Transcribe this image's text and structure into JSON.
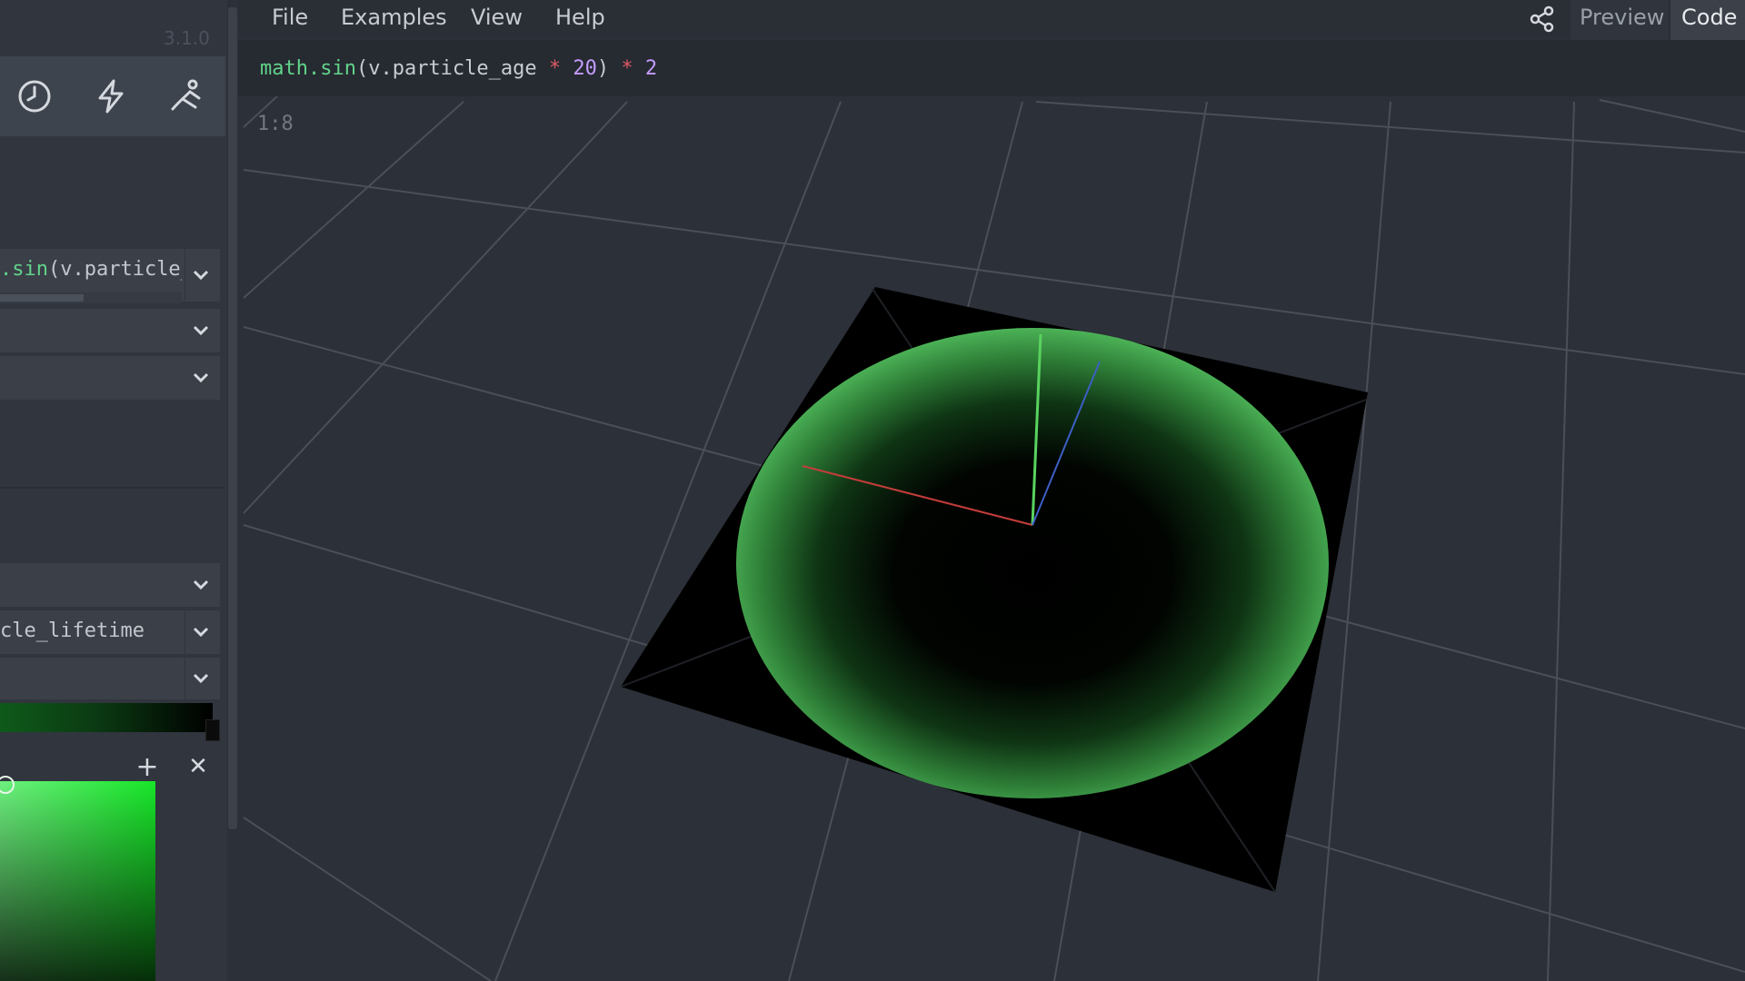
{
  "app": {
    "version": "3.1.0"
  },
  "sidebar": {
    "tools": [
      {
        "icon": "clock-icon"
      },
      {
        "icon": "lightning-icon"
      },
      {
        "icon": "motion-icon"
      }
    ],
    "dropdowns": [
      {
        "value_prefix": ".sin",
        "value_rest": "(v.particle_"
      },
      {
        "value_prefix": "",
        "value_rest": ""
      },
      {
        "value_prefix": "",
        "value_rest": ""
      },
      {
        "value_prefix": "",
        "value_rest": ""
      },
      {
        "value_prefix": "",
        "value_rest": "cle_lifetime"
      },
      {
        "value_prefix": "",
        "value_rest": ""
      }
    ],
    "gradient": {
      "start_color": "#0e5a1a",
      "end_color": "#000000"
    },
    "picker": {
      "add_label": "+",
      "remove_label": "✕",
      "hue_color": "#17e628"
    }
  },
  "menu": {
    "items": [
      "File",
      "Examples",
      "View",
      "Help"
    ]
  },
  "tabs": {
    "preview": "Preview",
    "code": "Code",
    "active": "Code"
  },
  "editor": {
    "code_tokens": [
      {
        "cls": "fn",
        "text": "math.sin"
      },
      {
        "cls": "txt",
        "text": "(v.particle_age "
      },
      {
        "cls": "op",
        "text": "*"
      },
      {
        "cls": "num",
        "text": " 20"
      },
      {
        "cls": "txt",
        "text": ") "
      },
      {
        "cls": "op",
        "text": "*"
      },
      {
        "cls": "num",
        "text": " 2"
      }
    ],
    "cursor_position": "1:8"
  },
  "viewport": {
    "background": "#2c3038",
    "particle_color": "#46b452"
  }
}
